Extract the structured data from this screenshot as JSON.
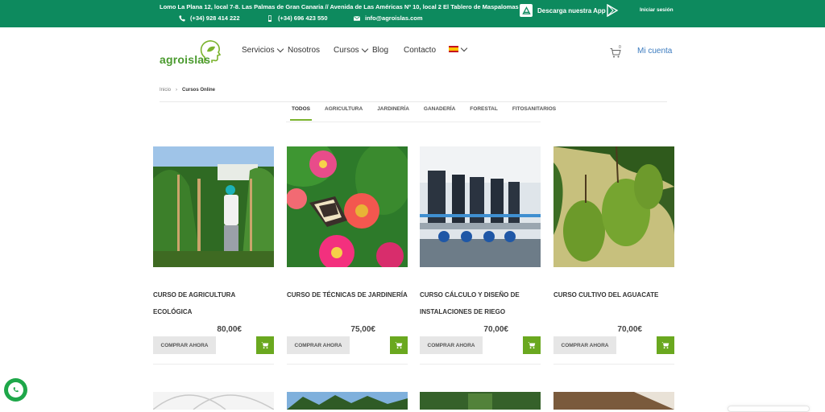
{
  "topbar": {
    "address": "Lomo La Plana 12, local 7-8. Las Palmas de Gran Canaria // Avenida de Las Américas Nº 10, local 2 El Tablero de Maspalomas",
    "phone1": "(+34) 928 414 222",
    "phone2": "(+34) 696 423 550",
    "email": "info@agroislas.com",
    "app_label": "Descarga nuestra App",
    "login": "Iniciar sesión",
    "bg_color": "#0d8a5e"
  },
  "header": {
    "logo_text": "agroislas",
    "nav": [
      {
        "label": "Servicios",
        "has_dropdown": true
      },
      {
        "label": "Nosotros",
        "has_dropdown": false
      },
      {
        "label": "Cursos",
        "has_dropdown": true
      },
      {
        "label": "Blog",
        "has_dropdown": false
      },
      {
        "label": "Contacto",
        "has_dropdown": false
      }
    ],
    "language_icon": "spain-flag-icon",
    "cart_count": "0",
    "account": "Mi cuenta"
  },
  "breadcrumb": {
    "home": "Inicio",
    "separator": "›",
    "current": "Cursos Online"
  },
  "filters": [
    "TODOS",
    "AGRICULTURA",
    "JARDINERÍA",
    "GANADERÍA",
    "FORESTAL",
    "FITOSANITARIOS"
  ],
  "active_filter": "TODOS",
  "products": [
    {
      "title": "CURSO DE AGRICULTURA ECOLÓGICA",
      "price": "80,00€",
      "buy": "COMPRAR AHORA"
    },
    {
      "title": "CURSO DE TÉCNICAS DE JARDINERÍA",
      "price": "75,00€",
      "buy": "COMPRAR AHORA"
    },
    {
      "title": "CURSO CÁLCULO Y DISEÑO DE INSTALACIONES DE RIEGO",
      "price": "70,00€",
      "buy": "COMPRAR AHORA"
    },
    {
      "title": "CURSO CULTIVO DEL AGUACATE",
      "price": "70,00€",
      "buy": "COMPRAR AHORA"
    }
  ],
  "colors": {
    "accent_green": "#6aa81f",
    "link_blue": "#3b7bbf"
  }
}
